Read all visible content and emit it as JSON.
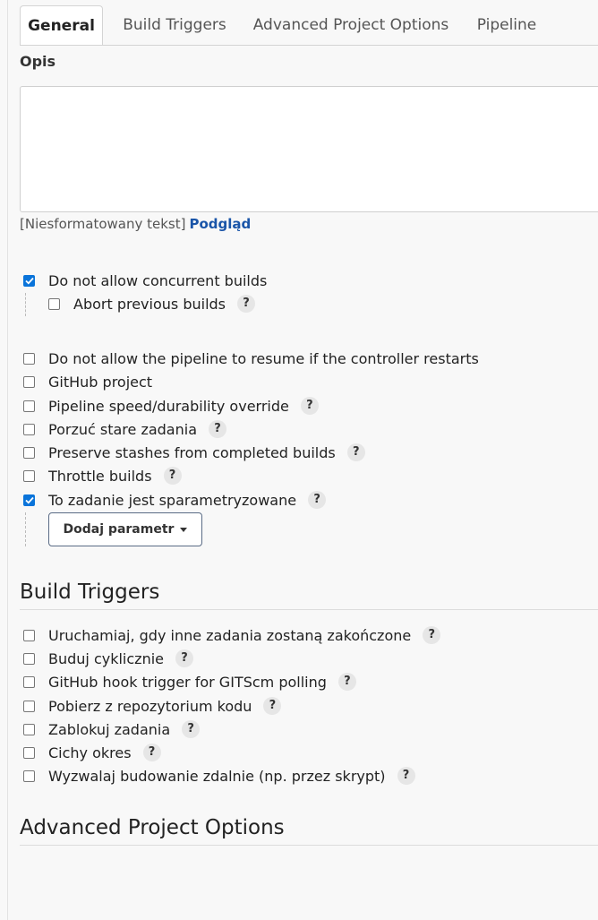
{
  "tabs": [
    {
      "label": "General",
      "active": true
    },
    {
      "label": "Build Triggers",
      "active": false
    },
    {
      "label": "Advanced Project Options",
      "active": false
    },
    {
      "label": "Pipeline",
      "active": false
    }
  ],
  "general": {
    "description_label": "Opis",
    "description_value": "",
    "format_note": "[Niesformatowany tekst]",
    "preview_link": "Podgląd",
    "options": [
      {
        "label": "Do not allow concurrent builds",
        "checked": true,
        "help": false
      },
      {
        "label": "Abort previous builds",
        "checked": false,
        "help": true
      },
      {
        "label": "Do not allow the pipeline to resume if the controller restarts",
        "checked": false,
        "help": false
      },
      {
        "label": "GitHub project",
        "checked": false,
        "help": false
      },
      {
        "label": "Pipeline speed/durability override",
        "checked": false,
        "help": true
      },
      {
        "label": "Porzuć stare zadania",
        "checked": false,
        "help": true
      },
      {
        "label": "Preserve stashes from completed builds",
        "checked": false,
        "help": true
      },
      {
        "label": "Throttle builds",
        "checked": false,
        "help": true
      },
      {
        "label": "To zadanie jest sparametryzowane",
        "checked": true,
        "help": true
      }
    ],
    "add_param_button": "Dodaj parametr"
  },
  "build_triggers": {
    "title": "Build Triggers",
    "options": [
      {
        "label": "Uruchamiaj, gdy inne zadania zostaną zakończone",
        "checked": false
      },
      {
        "label": "Buduj cyklicznie",
        "checked": false
      },
      {
        "label": "GitHub hook trigger for GITScm polling",
        "checked": false
      },
      {
        "label": "Pobierz z repozytorium kodu",
        "checked": false
      },
      {
        "label": "Zablokuj zadania",
        "checked": false
      },
      {
        "label": "Cichy okres",
        "checked": false
      },
      {
        "label": "Wyzwalaj budowanie zdalnie (np. przez skrypt)",
        "checked": false
      }
    ]
  },
  "advanced": {
    "title": "Advanced Project Options"
  },
  "help_symbol": "?"
}
